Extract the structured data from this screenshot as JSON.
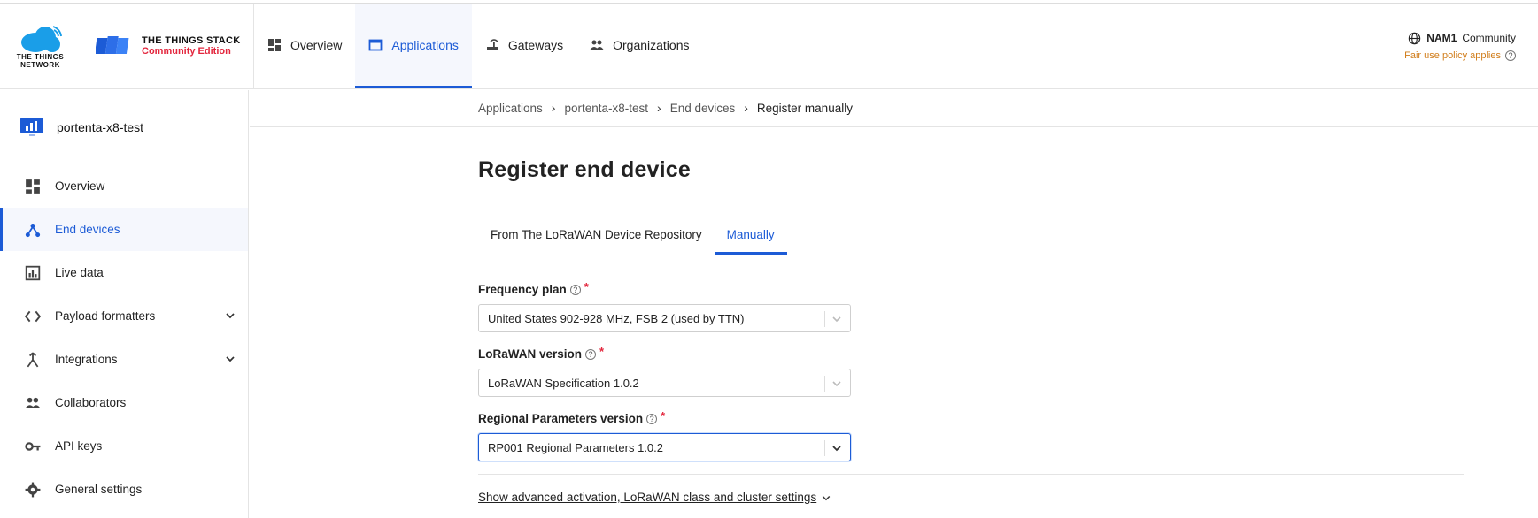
{
  "brand": {
    "ttn_name": "THE THINGS NETWORK",
    "stack_name": "THE THINGS STACK",
    "edition": "Community Edition"
  },
  "nav": {
    "items": [
      {
        "label": "Overview",
        "icon": "dashboard-icon"
      },
      {
        "label": "Applications",
        "icon": "application-icon",
        "active": true
      },
      {
        "label": "Gateways",
        "icon": "gateway-icon"
      },
      {
        "label": "Organizations",
        "icon": "people-icon"
      }
    ]
  },
  "header_right": {
    "cluster_code": "NAM1",
    "cluster_label": "Community",
    "fair_use": "Fair use policy applies"
  },
  "sidebar": {
    "app_name": "portenta-x8-test",
    "items": [
      {
        "label": "Overview"
      },
      {
        "label": "End devices",
        "active": true
      },
      {
        "label": "Live data"
      },
      {
        "label": "Payload formatters",
        "expandable": true
      },
      {
        "label": "Integrations",
        "expandable": true
      },
      {
        "label": "Collaborators"
      },
      {
        "label": "API keys"
      },
      {
        "label": "General settings"
      }
    ]
  },
  "breadcrumb": [
    "Applications",
    "portenta-x8-test",
    "End devices",
    "Register manually"
  ],
  "page": {
    "title": "Register end device",
    "tabs": [
      "From The LoRaWAN Device Repository",
      "Manually"
    ],
    "active_tab": "Manually"
  },
  "form": {
    "frequency_plan": {
      "label": "Frequency plan",
      "value": "United States 902-928 MHz, FSB 2 (used by TTN)"
    },
    "lorawan_version": {
      "label": "LoRaWAN version",
      "value": "LoRaWAN Specification 1.0.2"
    },
    "regional_params": {
      "label": "Regional Parameters version",
      "value": "RP001 Regional Parameters 1.0.2"
    },
    "advanced_link": "Show advanced activation, LoRaWAN class and cluster settings"
  },
  "colors": {
    "accent": "#1c5bd6",
    "brand_red": "#e3263d",
    "warning": "#d17d1a"
  }
}
